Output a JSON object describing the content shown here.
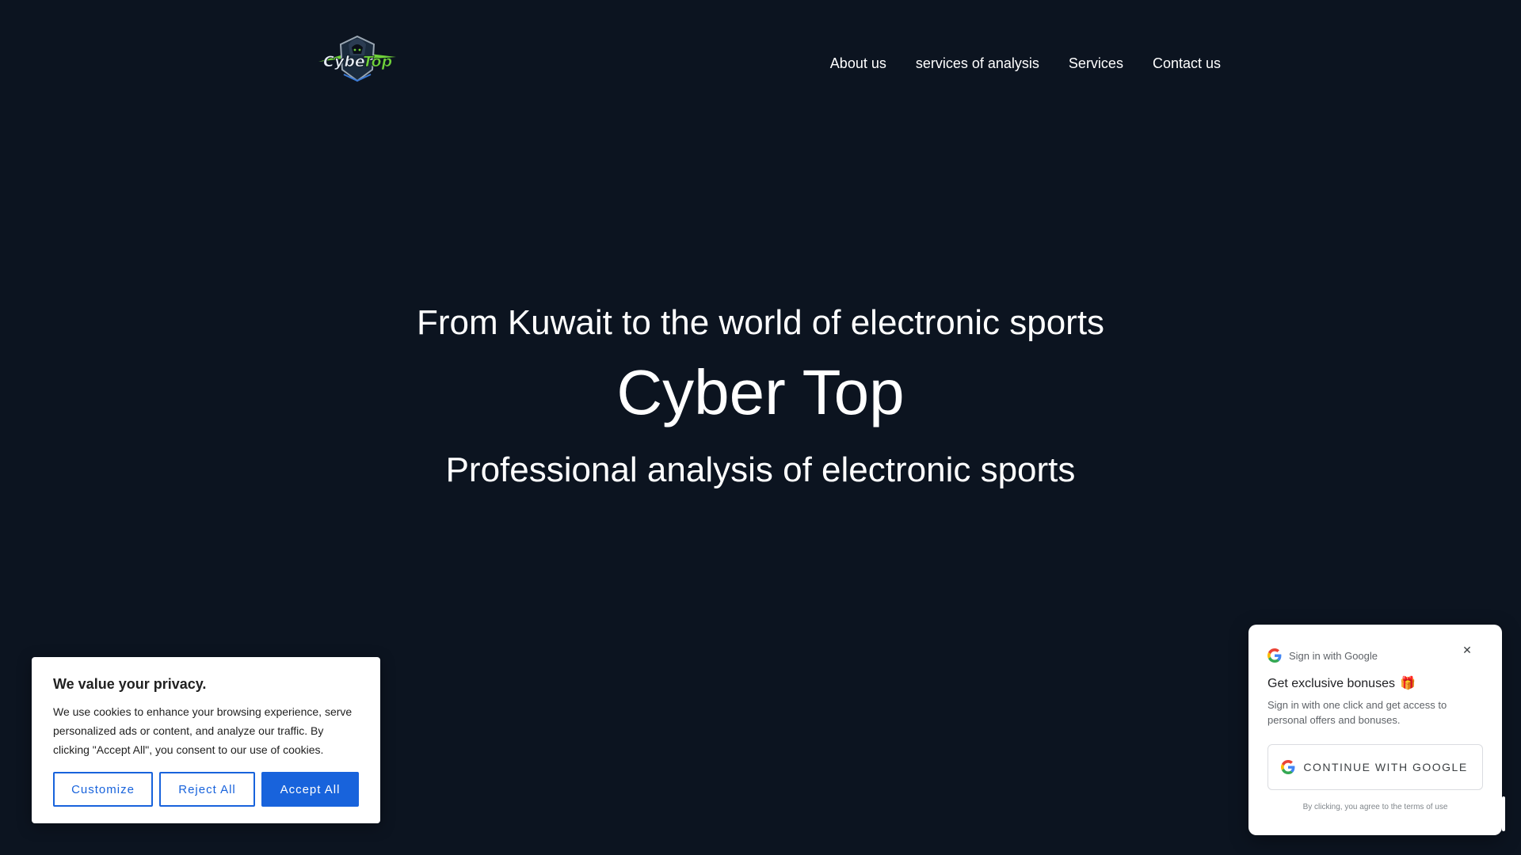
{
  "header": {
    "logo_text": "CyberTop",
    "nav": [
      {
        "label": "About us"
      },
      {
        "label": "services of analysis"
      },
      {
        "label": "Services"
      },
      {
        "label": "Contact us"
      }
    ]
  },
  "hero": {
    "tagline": "From Kuwait to the world of electronic sports",
    "title": "Cyber Top",
    "subtitle": "Professional analysis of electronic sports"
  },
  "cookie_banner": {
    "title": "We value your privacy.",
    "text": "We use cookies to enhance your browsing experience, serve personalized ads or content, and analyze our traffic. By clicking \"Accept All\", you consent to our use of cookies.",
    "customize_label": "Customize",
    "reject_label": "Reject All",
    "accept_label": "Accept All"
  },
  "google_popup": {
    "header": "Sign in with Google",
    "close_icon": "close-icon",
    "bonus_title": "Get exclusive bonuses",
    "gift_icon": "gift-icon",
    "description": "Sign in with one click and get access to personal offers and bonuses.",
    "continue_label": "CONTINUE WITH GOOGLE",
    "terms": "By clicking, you agree to the terms of use"
  },
  "colors": {
    "background": "#0c1420",
    "accent_blue": "#1863dc",
    "logo_green": "#6fd13a"
  }
}
